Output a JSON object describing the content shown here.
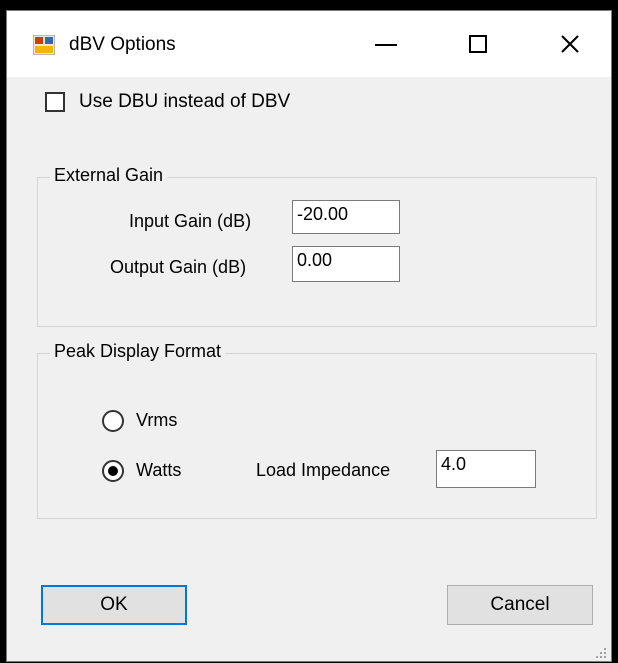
{
  "window": {
    "title": "dBV Options",
    "icon": "app-icon"
  },
  "options": {
    "use_dbu_label": "Use DBU instead of DBV",
    "use_dbu_checked": false
  },
  "external_gain": {
    "legend": "External Gain",
    "input_gain_label": "Input Gain (dB)",
    "input_gain_value": "-20.00",
    "output_gain_label": "Output Gain (dB)",
    "output_gain_value": "0.00"
  },
  "peak_display": {
    "legend": "Peak Display Format",
    "vrms_label": "Vrms",
    "watts_label": "Watts",
    "selected": "Watts",
    "load_impedance_label": "Load Impedance",
    "load_impedance_value": "4.0"
  },
  "buttons": {
    "ok_label": "OK",
    "cancel_label": "Cancel"
  },
  "colors": {
    "accent_focus": "#0078d7",
    "dialog_bg": "#f0f0f0"
  }
}
